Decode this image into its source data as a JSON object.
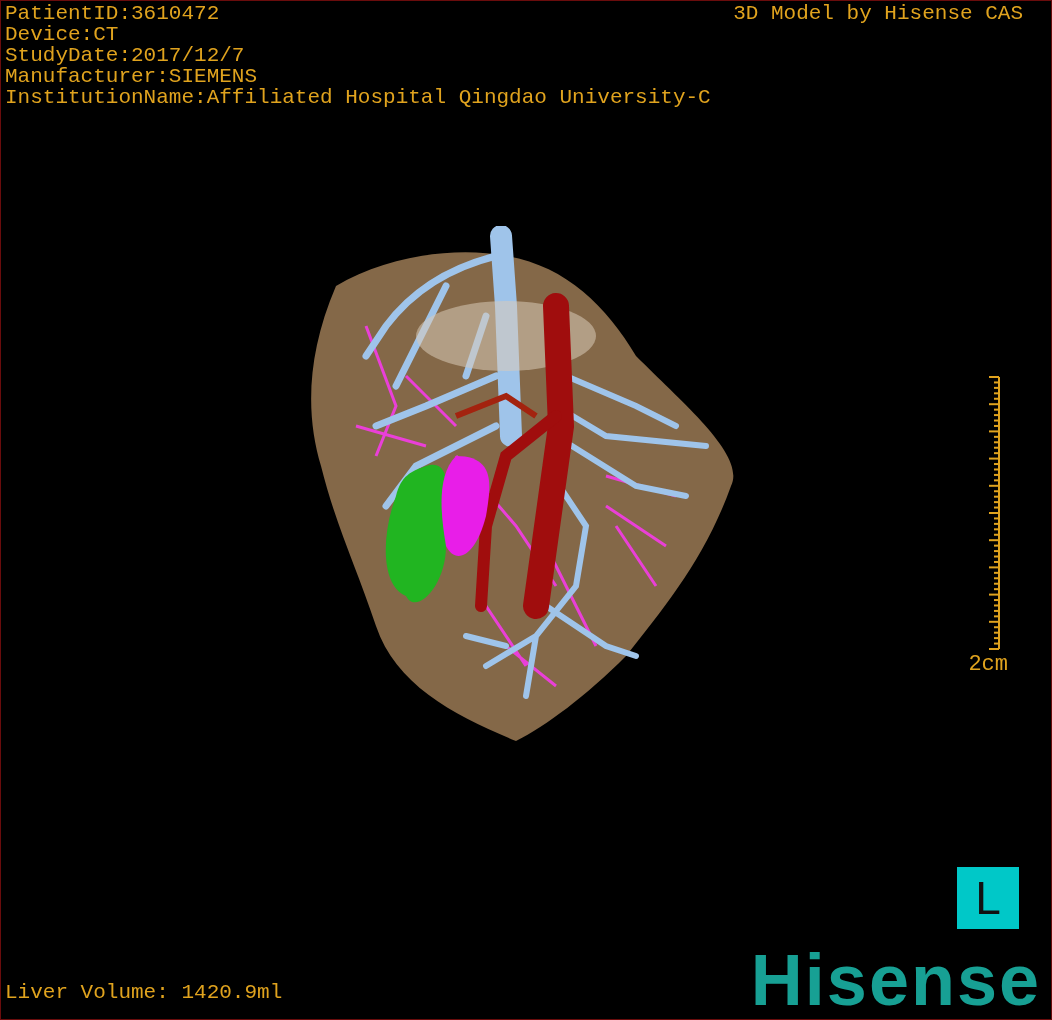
{
  "info_lines": [
    "PatientID:3610472",
    "Device:CT",
    "StudyDate:2017/12/7",
    "Manufacturer:SIEMENS",
    "InstitutionName:Affiliated Hospital Qingdao University-C"
  ],
  "model_credit": "3D Model by Hisense CAS",
  "scale_bar": {
    "label": "2cm"
  },
  "orientation_marker": "L",
  "volume": "Liver Volume: 1420.9ml",
  "logo": "Hisense"
}
